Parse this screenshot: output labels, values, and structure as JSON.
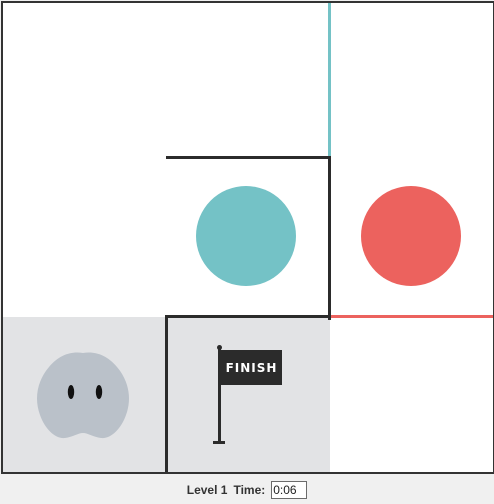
{
  "game": {
    "finish_flag_label": "FINISH",
    "colors": {
      "teal": "#74c2c6",
      "red": "#ec625e",
      "wall": "#2b2b2b",
      "shaded_cell": "#e2e3e5",
      "player": "#bac1c9"
    },
    "icons": {
      "player": "blob-creature-icon",
      "goal": "finish-flag-icon"
    }
  },
  "status": {
    "level_label": "Level 1",
    "time_label": "Time:",
    "time_value": "0:06"
  }
}
